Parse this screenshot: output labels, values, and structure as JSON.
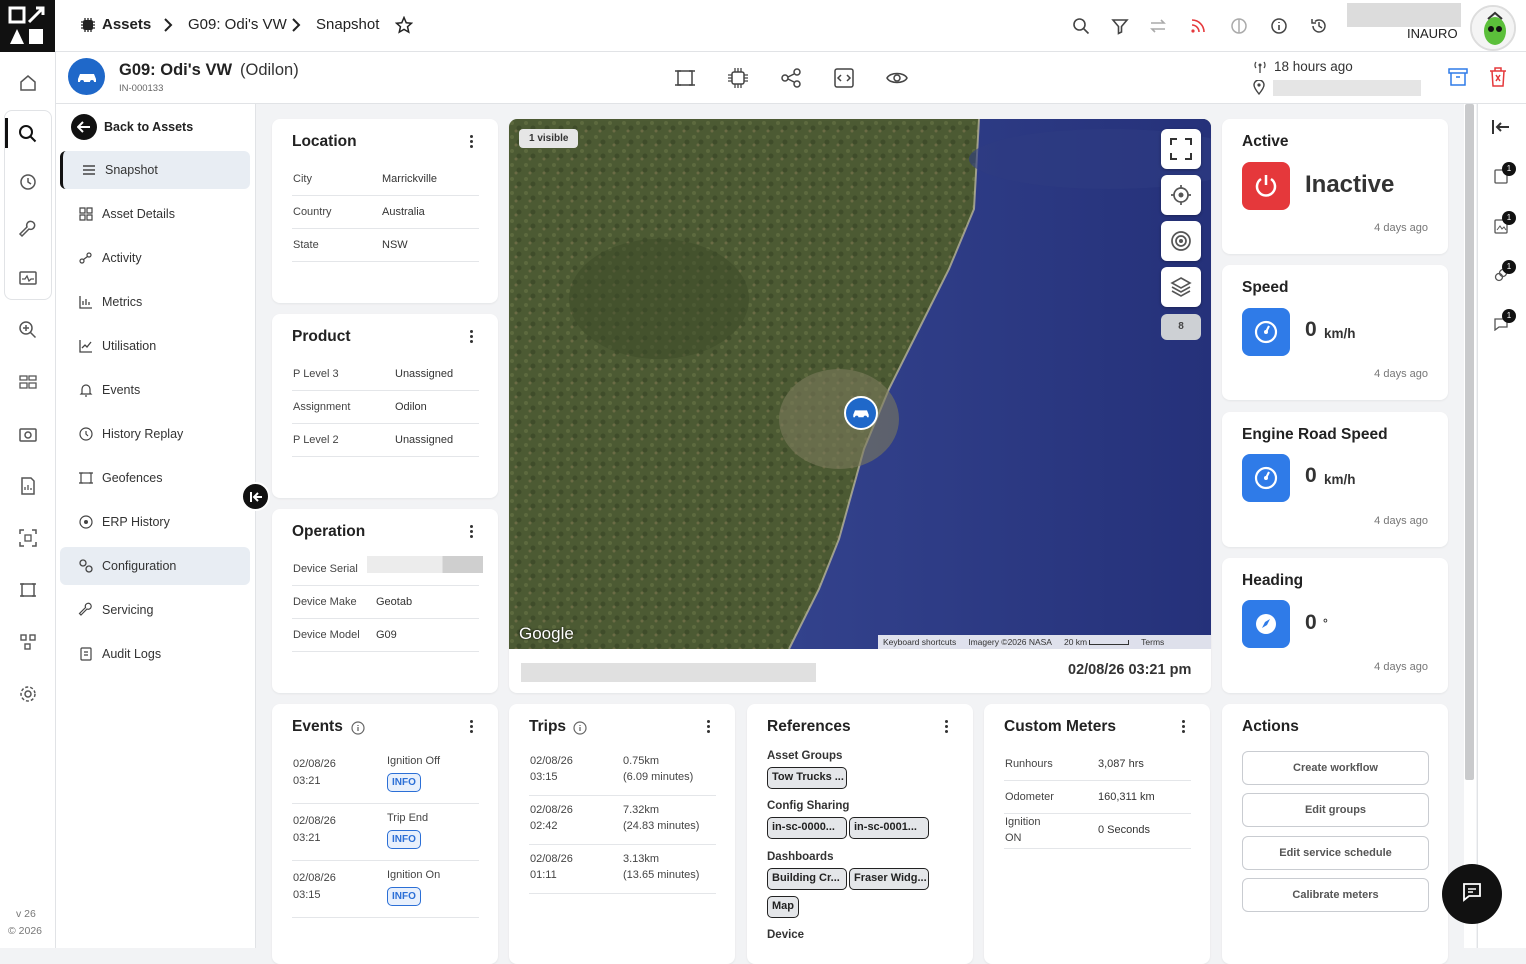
{
  "topbar": {
    "breadcrumb": [
      "Assets",
      "G09: Odi's VW",
      "Snapshot"
    ],
    "user": "INAURO"
  },
  "header": {
    "title": "G09: Odi's VW",
    "subtitle_name": "(Odilon)",
    "asset_id": "IN-000133",
    "last_seen": "18 hours ago"
  },
  "sidebar": {
    "back_label": "Back to Assets",
    "items": [
      {
        "label": "Snapshot",
        "icon": "list-icon"
      },
      {
        "label": "Asset Details",
        "icon": "grid-icon"
      },
      {
        "label": "Activity",
        "icon": "activity-icon"
      },
      {
        "label": "Metrics",
        "icon": "metrics-icon"
      },
      {
        "label": "Utilisation",
        "icon": "chart-icon"
      },
      {
        "label": "Events",
        "icon": "bell-icon"
      },
      {
        "label": "History Replay",
        "icon": "clock-icon"
      },
      {
        "label": "Geofences",
        "icon": "geofence-icon"
      },
      {
        "label": "ERP History",
        "icon": "erp-icon"
      },
      {
        "label": "Configuration",
        "icon": "config-icon"
      },
      {
        "label": "Servicing",
        "icon": "wrench-icon"
      },
      {
        "label": "Audit Logs",
        "icon": "audit-icon"
      }
    ]
  },
  "rail": {
    "version": "v 26",
    "copyright": "© 2026"
  },
  "location": {
    "title": "Location",
    "rows": [
      {
        "k": "City",
        "v": "Marrickville"
      },
      {
        "k": "Country",
        "v": "Australia"
      },
      {
        "k": "State",
        "v": "NSW"
      }
    ]
  },
  "product": {
    "title": "Product",
    "rows": [
      {
        "k": "P Level 3",
        "v": "Unassigned"
      },
      {
        "k": "Assignment",
        "v": "Odilon"
      },
      {
        "k": "P Level 2",
        "v": "Unassigned"
      }
    ]
  },
  "operation": {
    "title": "Operation",
    "rows": [
      {
        "k": "Device Serial",
        "v": ""
      },
      {
        "k": "Device Make",
        "v": "Geotab"
      },
      {
        "k": "Device Model",
        "v": "G09"
      }
    ]
  },
  "map": {
    "visible_badge": "1 visible",
    "layer_count": "8",
    "google": "Google",
    "attribution": [
      "Keyboard shortcuts",
      "Imagery ©2026 NASA",
      "20 km",
      "Terms"
    ],
    "timestamp": "02/08/26 03:21 pm"
  },
  "status": {
    "active": {
      "title": "Active",
      "value": "Inactive",
      "ago": "4 days ago"
    },
    "speed": {
      "title": "Speed",
      "value": "0",
      "unit": "km/h",
      "ago": "4 days ago"
    },
    "engine": {
      "title": "Engine Road Speed",
      "value": "0",
      "unit": "km/h",
      "ago": "4 days ago"
    },
    "heading": {
      "title": "Heading",
      "value": "0",
      "unit": "°",
      "ago": "4 days ago"
    }
  },
  "events": {
    "title": "Events",
    "rows": [
      {
        "date": "02/08/26",
        "time": "03:21",
        "name": "Ignition Off",
        "badge": "INFO"
      },
      {
        "date": "02/08/26",
        "time": "03:21",
        "name": "Trip End",
        "badge": "INFO"
      },
      {
        "date": "02/08/26",
        "time": "03:15",
        "name": "Ignition On",
        "badge": "INFO"
      }
    ]
  },
  "trips": {
    "title": "Trips",
    "rows": [
      {
        "date": "02/08/26",
        "time": "03:15",
        "dist": "0.75km",
        "dur": "(6.09 minutes)"
      },
      {
        "date": "02/08/26",
        "time": "02:42",
        "dist": "7.32km",
        "dur": "(24.83 minutes)"
      },
      {
        "date": "02/08/26",
        "time": "01:11",
        "dist": "3.13km",
        "dur": "(13.65 minutes)"
      }
    ]
  },
  "references": {
    "title": "References",
    "groups_label": "Asset Groups",
    "groups": [
      "Tow Trucks ..."
    ],
    "sharing_label": "Config Sharing",
    "sharing": [
      "in-sc-0000...",
      "in-sc-0001..."
    ],
    "dashboards_label": "Dashboards",
    "dashboards": [
      "Building Cr...",
      "Fraser Widg...",
      "Map"
    ],
    "device_label": "Device"
  },
  "meters": {
    "title": "Custom Meters",
    "rows": [
      {
        "k": "Runhours",
        "k2": "",
        "v": "3,087 hrs"
      },
      {
        "k": "Odometer",
        "k2": "",
        "v": "160,311 km"
      },
      {
        "k": "Ignition",
        "k2": "ON",
        "v": "0 Seconds"
      }
    ]
  },
  "actions": {
    "title": "Actions",
    "buttons": [
      "Create workflow",
      "Edit groups",
      "Edit service schedule",
      "Calibrate meters"
    ]
  },
  "right_rail": {
    "counts": [
      "1",
      "1",
      "1",
      "1"
    ]
  },
  "colors": {
    "inactive_red": "#e5383b",
    "accent_blue": "#2f7be8",
    "chip_border": "#222"
  }
}
